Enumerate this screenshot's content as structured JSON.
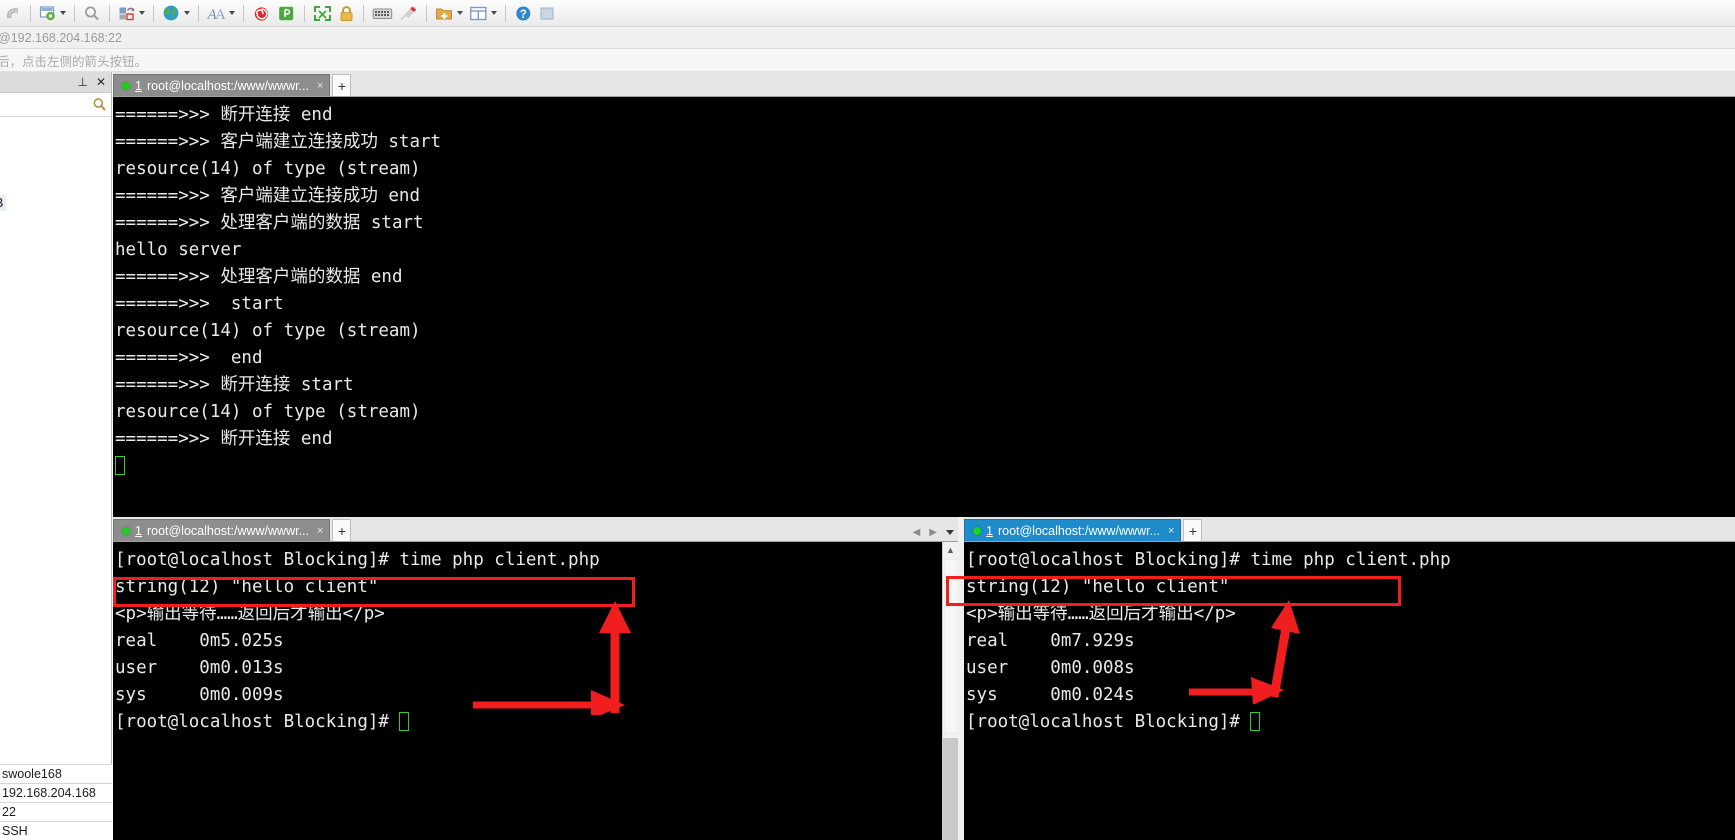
{
  "toolbar": {
    "icons": [
      {
        "name": "back-icon",
        "label": "Back"
      },
      {
        "name": "session-settings-icon",
        "label": "Session Options",
        "caret": true
      },
      {
        "name": "search-icon",
        "label": "Find"
      },
      {
        "name": "transfer-icon",
        "label": "Transfer",
        "caret": true
      },
      {
        "name": "globe-icon",
        "label": "Web Browse",
        "caret": true
      },
      {
        "name": "font-icon",
        "label": "Font",
        "caret": true
      },
      {
        "name": "snail-icon",
        "label": "Snail"
      },
      {
        "name": "plugin-icon",
        "label": "Plugin"
      },
      {
        "name": "fullscreen-icon",
        "label": "Full Screen"
      },
      {
        "name": "lock-icon",
        "label": "Lock"
      },
      {
        "name": "keyboard-icon",
        "label": "Keyboard"
      },
      {
        "name": "pen-icon",
        "label": "Edit"
      },
      {
        "name": "new-folder-icon",
        "label": "New",
        "caret": true
      },
      {
        "name": "layout-icon",
        "label": "Layout",
        "caret": true
      },
      {
        "name": "help-icon",
        "label": "Help"
      },
      {
        "name": "overflow-icon",
        "label": "More"
      }
    ]
  },
  "address_bar": {
    "text": "@192.168.204.168:22"
  },
  "hint_bar": {
    "text": "后，点击左侧的箭头按钮。"
  },
  "sidebar": {
    "pin_label": "⊥",
    "close_label": "✕",
    "search_placeholder": "",
    "search_icon": "search-icon",
    "tree_item": "B",
    "properties": [
      "swoole168",
      "192.168.204.168",
      "22",
      "SSH"
    ]
  },
  "top_pane": {
    "tab": {
      "number": "1",
      "title": "root@localhost:/www/wwwr...",
      "close": "×",
      "status_color": "#1fd01f"
    },
    "add_tab_label": "+",
    "terminal_lines": [
      "======>>> 断开连接 end",
      "======>>> 客户端建立连接成功 start",
      "resource(14) of type (stream)",
      "======>>> 客户端建立连接成功 end",
      "======>>> 处理客户端的数据 start",
      "hello server",
      "======>>> 处理客户端的数据 end",
      "======>>>  start",
      "resource(14) of type (stream)",
      "======>>>  end",
      "======>>> 断开连接 start",
      "resource(14) of type (stream)",
      "======>>> 断开连接 end"
    ]
  },
  "bottom_left_pane": {
    "tab": {
      "number": "1",
      "title": "root@localhost:/www/wwwr...",
      "close": "×",
      "status_color": "#1fd01f"
    },
    "add_tab_label": "+",
    "nav_prev": "◀",
    "nav_next": "▶",
    "terminal_lines": [
      "[root@localhost Blocking]# time php client.php",
      "string(12) \"hello client\"",
      "<p>输出等待……返回后才输出</p>",
      "real    0m5.025s",
      "user    0m0.013s",
      "sys     0m0.009s",
      "[root@localhost Blocking]# "
    ],
    "highlighted_line_index": 2,
    "timings": {
      "real": "0m5.025s",
      "user": "0m0.013s",
      "sys": "0m0.009s"
    }
  },
  "bottom_right_pane": {
    "tab": {
      "number": "1",
      "title": "root@localhost:/www/wwwr...",
      "close": "×",
      "status_color": "#1fd01f",
      "active": true
    },
    "add_tab_label": "+",
    "terminal_lines": [
      "[root@localhost Blocking]# time php client.php",
      "string(12) \"hello client\"",
      "<p>输出等待……返回后才输出</p>",
      "real    0m7.929s",
      "user    0m0.008s",
      "sys     0m0.024s",
      "[root@localhost Blocking]# "
    ],
    "highlighted_line_index": 2,
    "timings": {
      "real": "0m7.929s",
      "user": "0m0.008s",
      "sys": "0m0.024s"
    }
  },
  "annotations": {
    "highlight_color": "#f01e1e",
    "arrow_color": "#f01e1e"
  }
}
